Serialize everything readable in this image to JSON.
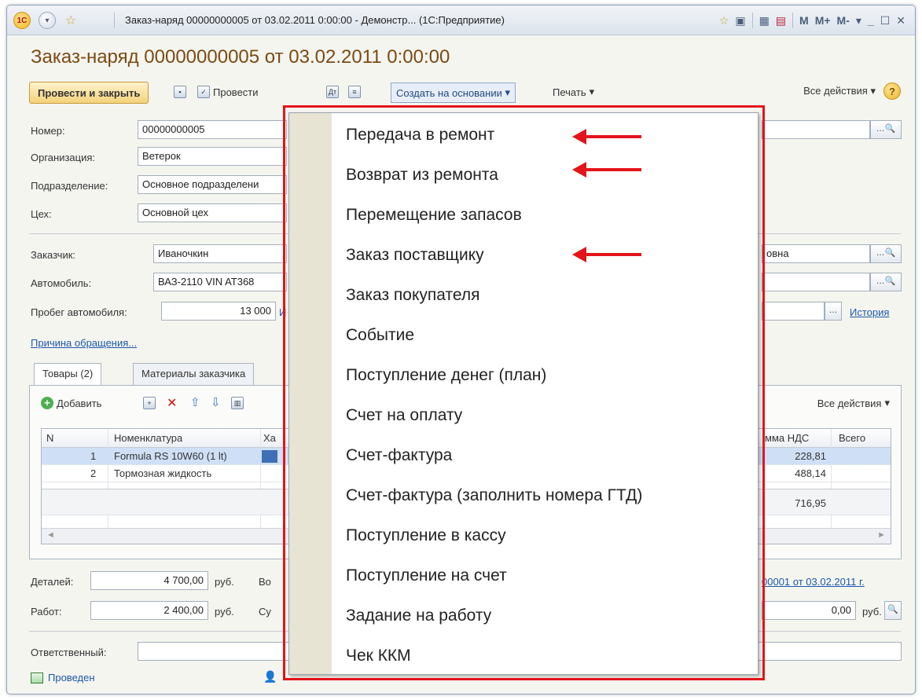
{
  "window": {
    "title": "Заказ-наряд 00000000005 от 03.02.2011 0:00:00 - Демонстр... (1С:Предприятие)",
    "logo": "1С",
    "icons": [
      "star-icon",
      "bookmark-icon",
      "calculator-icon",
      "calendar-icon"
    ],
    "mem_buttons": [
      "M",
      "M+",
      "M-"
    ]
  },
  "heading": "Заказ-наряд 00000000005 от 03.02.2011 0:00:00",
  "toolbar": {
    "post_close": "Провести и закрыть",
    "post": "Провести",
    "create_based": "Создать на основании",
    "print": "Печать",
    "all_actions": "Все действия",
    "help": "?"
  },
  "form": {
    "number_label": "Номер:",
    "number_value": "00000000005",
    "org_label": "Организация:",
    "org_value": "Ветерок",
    "dept_label": "Подразделение:",
    "dept_value": "Основное подразделени",
    "shop_label": "Цех:",
    "shop_value": "Основной цех",
    "customer_label": "Заказчик:",
    "customer_value": "Иваночкин",
    "customer_right": "овна",
    "car_label": "Автомобиль:",
    "car_value": "ВАЗ-2110 VIN AT368",
    "mileage_label": "Пробег автомобиля:",
    "mileage_value": "13 000",
    "mileage_suffix": "И",
    "history_link": "История",
    "reason_link": "Причина обращения..."
  },
  "tabs": [
    "Товары (2)",
    "Материалы заказчика"
  ],
  "grid_toolbar": {
    "add": "Добавить",
    "all_actions": "Все действия"
  },
  "grid": {
    "headers": [
      "N",
      "Номенклатура",
      "Ха",
      "мма НДС",
      "Всего"
    ],
    "rows": [
      {
        "n": "1",
        "name": "Formula RS 10W60 (1 lt)",
        "vat": "228,81",
        "total": ""
      },
      {
        "n": "2",
        "name": "Тормозная жидкость",
        "vat": "488,14",
        "total": ""
      }
    ],
    "total_vat": "716,95"
  },
  "totals": {
    "parts_label": "Деталей:",
    "parts_value": "4 700,00",
    "parts_cur": "руб.",
    "parts_mid": "Во",
    "work_label": "Работ:",
    "work_value": "2 400,00",
    "work_cur": "руб.",
    "work_mid": "Су",
    "doc_link": "00001 от 03.02.2011 г.",
    "right_value": "0,00",
    "right_cur": "руб."
  },
  "responsible_label": "Ответственный:",
  "status_text": "Проведен",
  "menu": {
    "items": [
      "Передача в ремонт",
      "Возврат из ремонта",
      "Перемещение запасов",
      "Заказ поставщику",
      "Заказ покупателя",
      "Событие",
      "Поступление денег (план)",
      "Счет на оплату",
      "Счет-фактура",
      "Счет-фактура (заполнить номера ГТД)",
      "Поступление в кассу",
      "Поступление на счет",
      "Задание на работу",
      "Чек ККМ"
    ],
    "highlighted_indices": [
      0,
      1,
      3
    ],
    "highlight_color": "#e3141a"
  }
}
